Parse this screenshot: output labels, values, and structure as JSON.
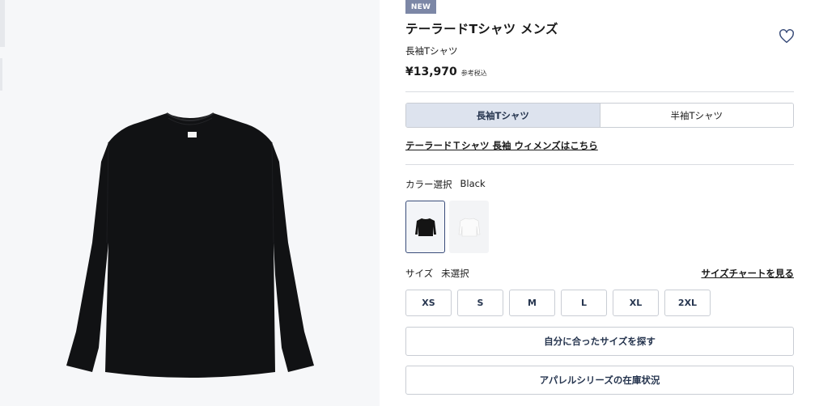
{
  "product": {
    "badge": "NEW",
    "title": "テーラードTシャツ メンズ",
    "subtitle": "長袖Tシャツ",
    "price": "¥13,970",
    "tax_note": "参考税込"
  },
  "sleeve_options": [
    {
      "label": "長袖Tシャツ",
      "selected": true
    },
    {
      "label": "半袖Tシャツ",
      "selected": false
    }
  ],
  "women_link": "テーラードＴシャツ 長袖 ウィメンズはこちら",
  "color": {
    "label": "カラー選択",
    "selected_value": "Black",
    "swatches": [
      {
        "name": "black",
        "hex": "#141414",
        "selected": true
      },
      {
        "name": "white",
        "hex": "#f2f2f2",
        "selected": false
      }
    ]
  },
  "size": {
    "label": "サイズ",
    "selected_value": "未選択",
    "chart_link": "サイズチャートを見る",
    "options": [
      "XS",
      "S",
      "M",
      "L",
      "XL",
      "2XL"
    ]
  },
  "buttons": {
    "find_size": "自分に合ったサイズを探す",
    "apparel_stock": "アパレルシリーズの在庫状況"
  },
  "colors": {
    "accent": "#26354f",
    "badge_bg": "#7c87a6",
    "selected_bg": "#dde3ee",
    "border": "#c9cdd4"
  }
}
